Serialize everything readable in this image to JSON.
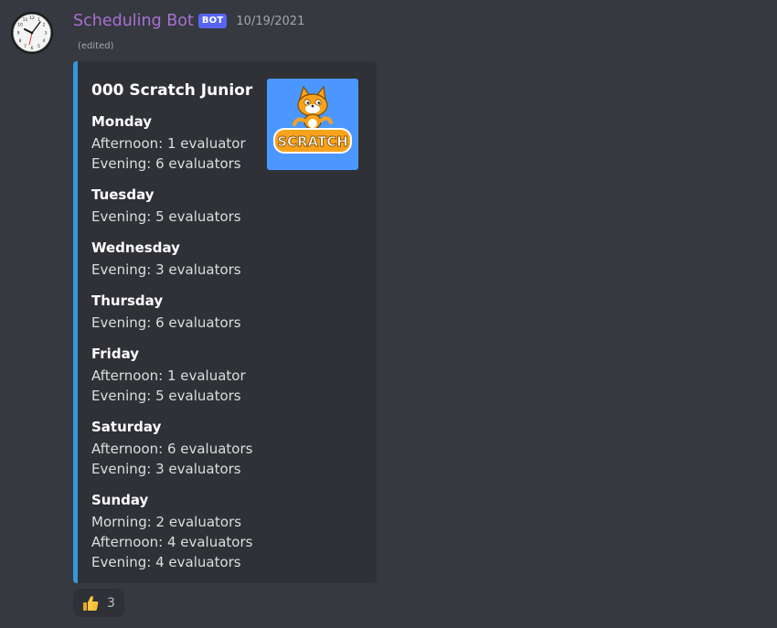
{
  "author": {
    "name": "Scheduling Bot",
    "tag": "BOT",
    "timestamp": "10/19/2021",
    "edited": "(edited)",
    "avatar_icon": "clock-icon"
  },
  "embed": {
    "accent_color": "#3498db",
    "title": "000 Scratch Junior",
    "thumbnail": "scratch-cat-logo",
    "thumbnail_text": "SCRATCH",
    "fields": [
      {
        "name": "Monday",
        "lines": [
          "Afternoon: 1 evaluator",
          "Evening: 6 evaluators"
        ]
      },
      {
        "name": "Tuesday",
        "lines": [
          "Evening: 5 evaluators"
        ]
      },
      {
        "name": "Wednesday",
        "lines": [
          "Evening: 3 evaluators"
        ]
      },
      {
        "name": "Thursday",
        "lines": [
          "Evening: 6 evaluators"
        ]
      },
      {
        "name": "Friday",
        "lines": [
          "Afternoon: 1 evaluator",
          "Evening: 5 evaluators"
        ]
      },
      {
        "name": "Saturday",
        "lines": [
          "Afternoon: 6 evaluators",
          "Evening: 3 evaluators"
        ]
      },
      {
        "name": "Sunday",
        "lines": [
          "Morning: 2 evaluators",
          "Afternoon: 4 evaluators",
          "Evening: 4 evaluators"
        ]
      }
    ]
  },
  "reaction": {
    "emoji_icon": "thumbs-up-icon",
    "count": "3"
  },
  "colors": {
    "background": "#36393f",
    "embed_background": "#2f3136",
    "username": "#a970d6",
    "bot_tag": "#5865f2"
  }
}
